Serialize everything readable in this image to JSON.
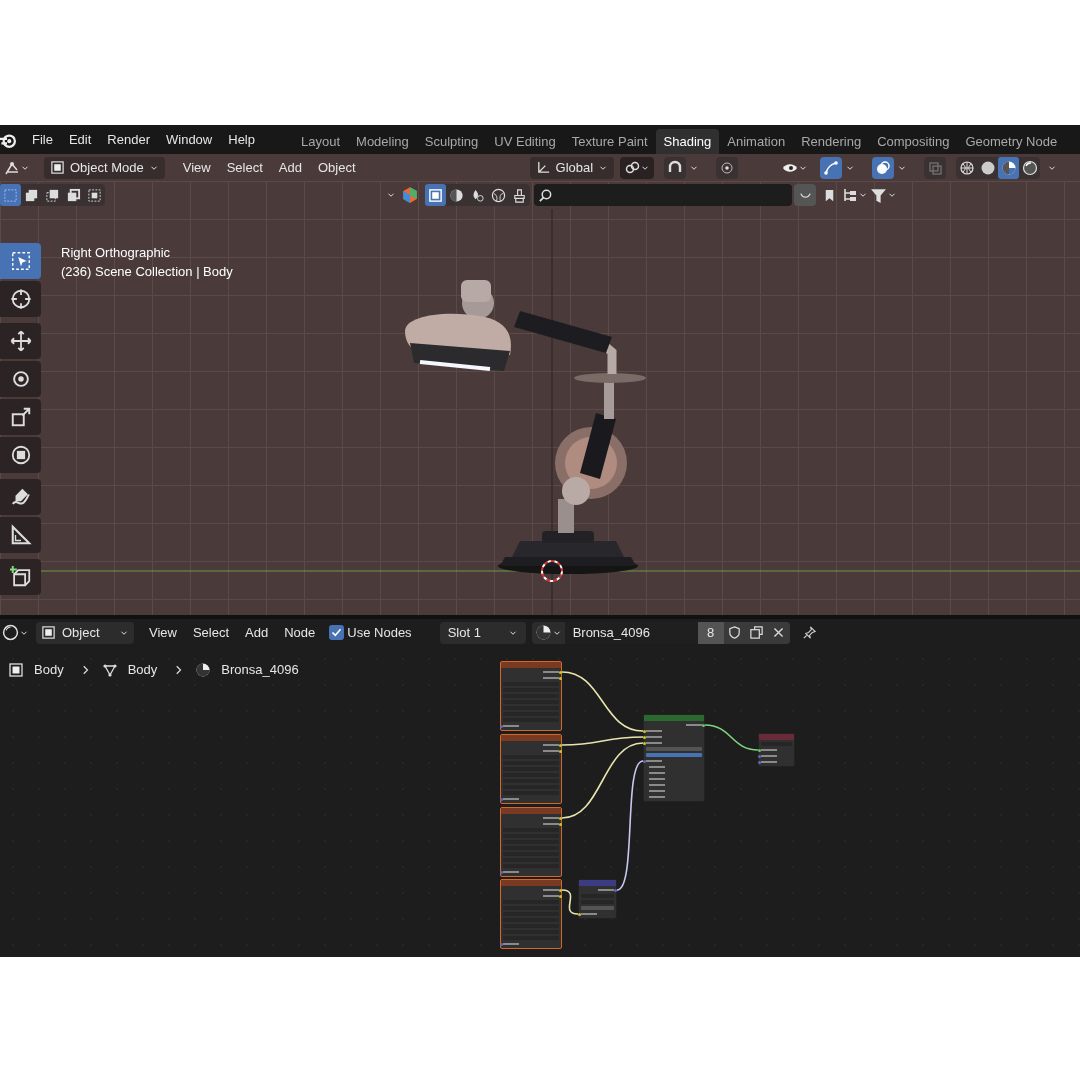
{
  "menu_bar": {
    "menus": [
      "File",
      "Edit",
      "Render",
      "Window",
      "Help"
    ],
    "workspaces": [
      {
        "label": "Layout",
        "selected": false
      },
      {
        "label": "Modeling",
        "selected": false
      },
      {
        "label": "Sculpting",
        "selected": false
      },
      {
        "label": "UV Editing",
        "selected": false
      },
      {
        "label": "Texture Paint",
        "selected": false
      },
      {
        "label": "Shading",
        "selected": true
      },
      {
        "label": "Animation",
        "selected": false
      },
      {
        "label": "Rendering",
        "selected": false
      },
      {
        "label": "Compositing",
        "selected": false
      },
      {
        "label": "Geometry Node",
        "selected": false
      }
    ]
  },
  "viewport_header": {
    "mode": "Object Mode",
    "menus": [
      "View",
      "Select",
      "Add",
      "Object"
    ],
    "orientation": "Global",
    "toggles": [
      {
        "kind": "snap",
        "on": false
      },
      {
        "kind": "proportional",
        "on": false
      },
      {
        "kind": "gizmo",
        "on": true
      },
      {
        "kind": "overlay",
        "on": true
      },
      {
        "kind": "xray",
        "on": false
      }
    ],
    "shading_modes": [
      {
        "kind": "wireframe",
        "selected": false
      },
      {
        "kind": "solid",
        "selected": false
      },
      {
        "kind": "material",
        "selected": true
      },
      {
        "kind": "rendered",
        "selected": false
      }
    ]
  },
  "tool_header": {
    "select_modes": [
      {
        "selected": true
      },
      {
        "selected": false
      },
      {
        "selected": false
      },
      {
        "selected": false
      },
      {
        "selected": false
      }
    ],
    "view_modes": [
      {
        "kind": "object",
        "selected": true
      },
      {
        "kind": "edit",
        "selected": false
      },
      {
        "kind": "sculpt",
        "selected": false
      },
      {
        "kind": "texture",
        "selected": false
      },
      {
        "kind": "paint",
        "selected": false
      }
    ]
  },
  "viewport": {
    "view_name": "Right Orthographic",
    "collection_info": "(236) Scene Collection | Body"
  },
  "toolbar": [
    {
      "kind": "select",
      "selected": true
    },
    {
      "kind": "cursor",
      "selected": false
    },
    {
      "kind": "move",
      "selected": false
    },
    {
      "kind": "rotate",
      "selected": false
    },
    {
      "kind": "scale",
      "selected": false
    },
    {
      "kind": "transform",
      "selected": false
    },
    {
      "kind": "annotate",
      "selected": false
    },
    {
      "kind": "measure",
      "selected": false
    },
    {
      "kind": "add_cube",
      "selected": false
    }
  ],
  "node_header": {
    "object_type": "Object",
    "menus": [
      "View",
      "Select",
      "Add",
      "Node"
    ],
    "use_nodes": {
      "label": "Use Nodes",
      "checked": true
    },
    "slot": "Slot 1",
    "material": "Bronsa_4096",
    "users": "8"
  },
  "breadcrumbs": [
    {
      "kind": "object",
      "label": "Body"
    },
    {
      "kind": "mesh",
      "label": "Body"
    },
    {
      "kind": "material",
      "label": "Bronsa_4096"
    }
  ],
  "nodes": [
    {
      "kind": "image_texture"
    },
    {
      "kind": "image_texture"
    },
    {
      "kind": "image_texture"
    },
    {
      "kind": "image_texture"
    },
    {
      "kind": "normal_map"
    },
    {
      "kind": "bsdf"
    },
    {
      "kind": "output"
    }
  ]
}
